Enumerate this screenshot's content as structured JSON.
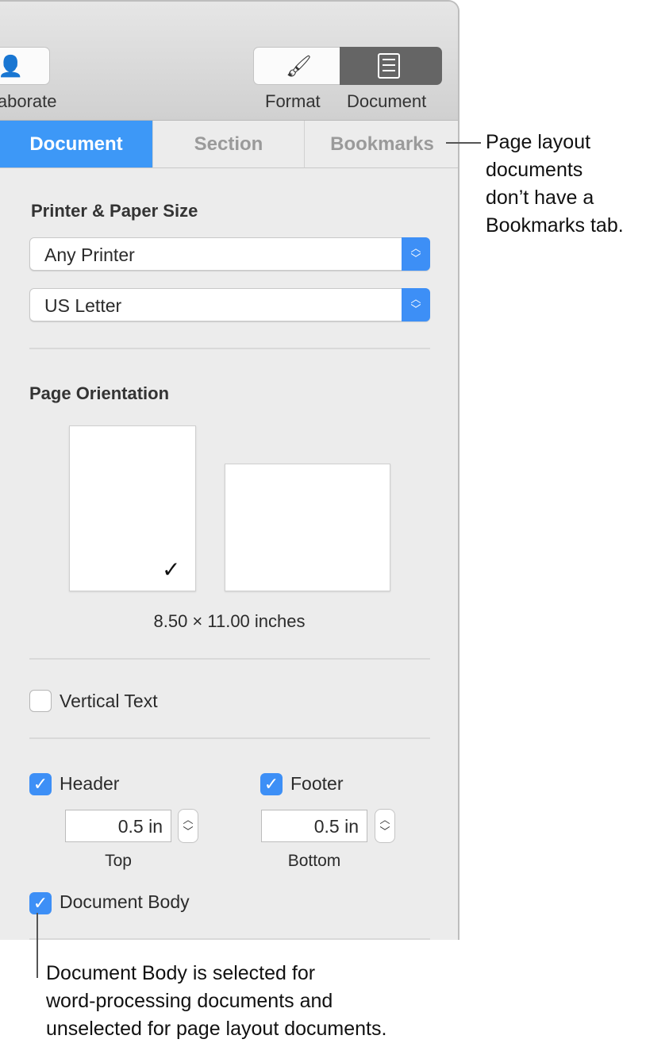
{
  "toolbar": {
    "collaborate_label": "Collaborate",
    "format_label": "Format",
    "document_label": "Document"
  },
  "tabs": [
    {
      "label": "Document",
      "active": true
    },
    {
      "label": "Section"
    },
    {
      "label": "Bookmarks"
    }
  ],
  "printer": {
    "heading": "Printer & Paper Size",
    "printer_value": "Any Printer",
    "paper_value": "US Letter"
  },
  "orientation": {
    "heading": "Page Orientation",
    "selected": "portrait",
    "size_text": "8.50 × 11.00 inches"
  },
  "vertical_text": {
    "label": "Vertical Text",
    "checked": false
  },
  "header": {
    "label": "Header",
    "checked": true,
    "value": "0.5 in",
    "sublabel": "Top"
  },
  "footer": {
    "label": "Footer",
    "checked": true,
    "value": "0.5 in",
    "sublabel": "Bottom"
  },
  "document_body": {
    "label": "Document Body",
    "checked": true
  },
  "callouts": {
    "bookmarks": [
      "Page layout",
      "documents",
      "don’t have a",
      "Bookmarks tab."
    ],
    "document_body": [
      "Document Body is selected for",
      "word-processing documents and",
      "unselected for page layout documents."
    ]
  },
  "colors": {
    "accent": "#3d98f7",
    "panel": "#ececec"
  }
}
